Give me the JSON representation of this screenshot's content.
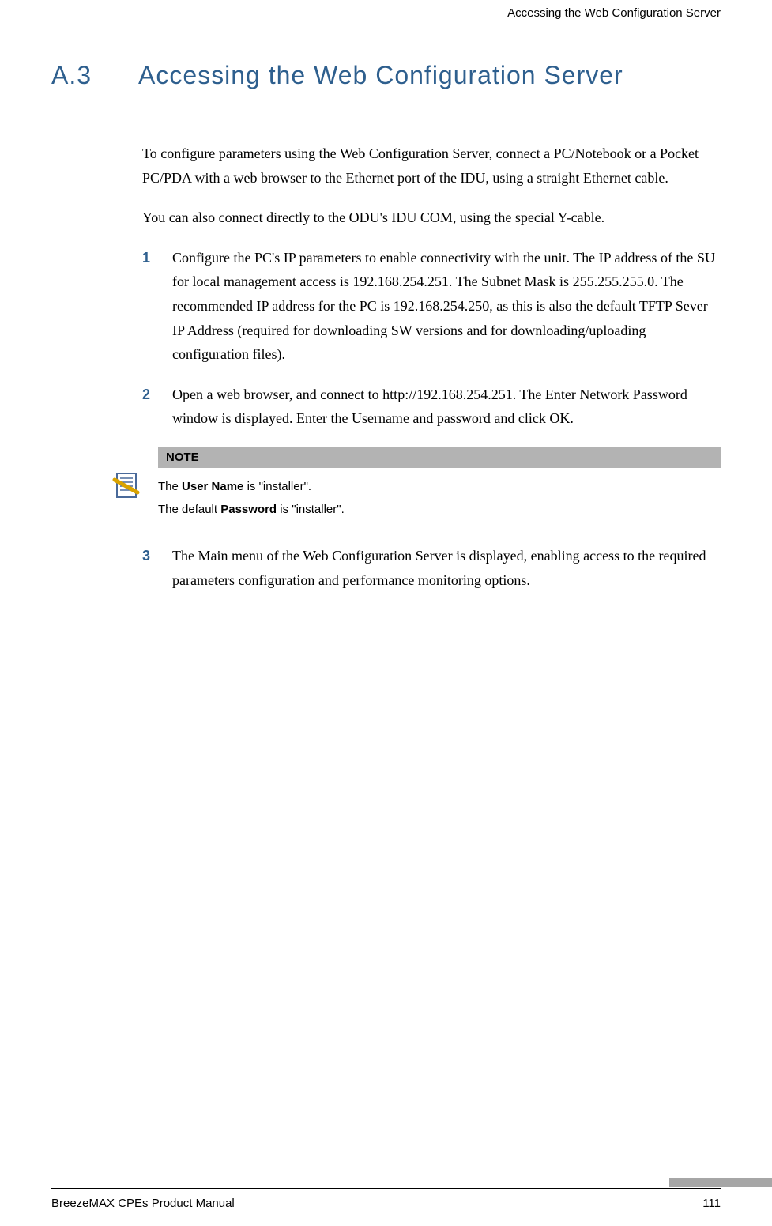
{
  "header": {
    "running_title": "Accessing the Web Configuration Server"
  },
  "section": {
    "number": "A.3",
    "title": "Accessing the Web Configuration Server"
  },
  "paragraphs": {
    "p1": "To configure parameters using the Web Configuration Server, connect a PC/Notebook or a Pocket PC/PDA with a web browser to the Ethernet port of the IDU, using a straight Ethernet cable.",
    "p2": "You can also connect directly to the ODU's IDU COM, using the special Y-cable."
  },
  "list": {
    "item1_num": "1",
    "item1": "Configure the PC's IP parameters to enable connectivity with the unit. The IP address of the SU for local management access is 192.168.254.251. The Subnet Mask is 255.255.255.0. The recommended IP address for the PC is 192.168.254.250, as this is also the default TFTP Sever IP Address (required for downloading SW versions and for downloading/uploading configuration files).",
    "item2_num": "2",
    "item2": "Open a web browser, and connect to http://192.168.254.251. The Enter Network Password window is displayed. Enter the Username and password and click OK.",
    "item3_num": "3",
    "item3": "The Main menu of the Web Configuration Server is displayed, enabling access to the required parameters configuration and performance monitoring options."
  },
  "note": {
    "label": "NOTE",
    "line1_pre": "The ",
    "line1_bold": "User Name",
    "line1_post": " is \"installer\".",
    "line2_pre": "The default ",
    "line2_bold": "Password",
    "line2_post": " is \"installer\"."
  },
  "footer": {
    "manual": "BreezeMAX CPEs Product Manual",
    "page": "111"
  }
}
